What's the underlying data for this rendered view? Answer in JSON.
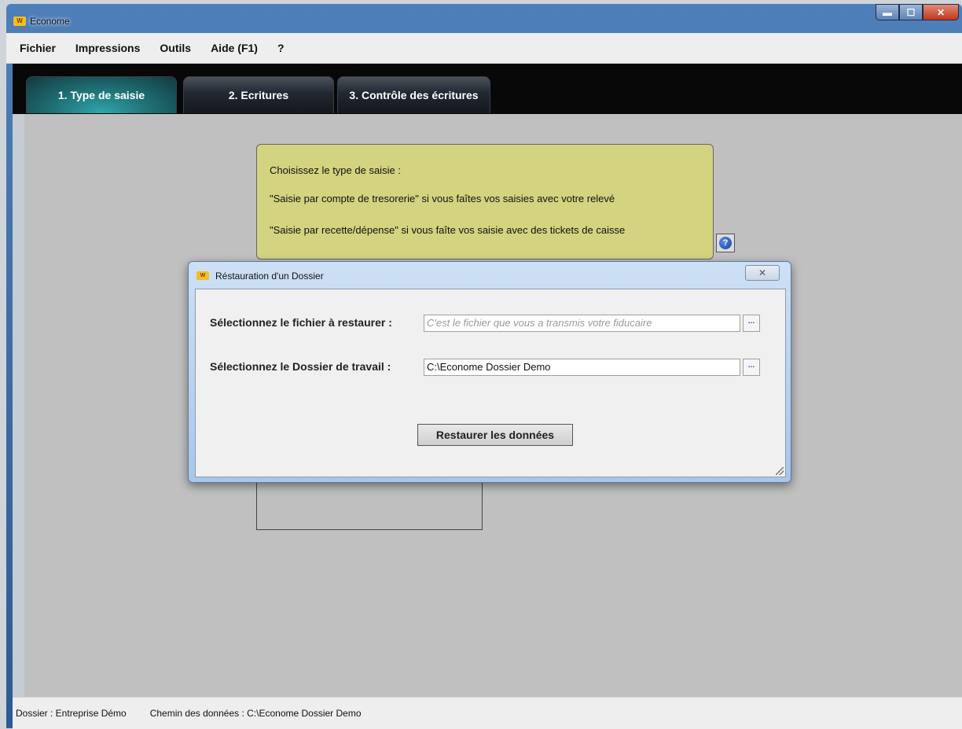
{
  "window": {
    "title": "Econome",
    "icon": "wd-app-icon",
    "controls": {
      "minimize": "▬",
      "maximize": "☐",
      "close": "✕"
    }
  },
  "menubar": {
    "items": [
      "Fichier",
      "Impressions",
      "Outils",
      "Aide (F1)",
      "?"
    ]
  },
  "tabs": [
    {
      "label": "1. Type de saisie",
      "active": true
    },
    {
      "label": "2. Ecritures",
      "active": false
    },
    {
      "label": "3. Contrôle des écritures",
      "active": false
    }
  ],
  "info_panel": {
    "line1": "Choisissez le type de saisie :",
    "line2": "\"Saisie par compte de tresorerie\" si vous faîtes vos saisies avec votre relevé",
    "line3": "\"Saisie par recette/dépense\" si vous faîte vos saisie avec des tickets de caisse"
  },
  "help_button": {
    "icon": "help-icon",
    "glyph": "?"
  },
  "dialog": {
    "title": "Réstauration d'un Dossier",
    "close_glyph": "✕",
    "file_label": "Sélectionnez le fichier à restaurer :",
    "file_placeholder": "C'est le fichier que vous a transmis votre fiducaire",
    "file_value": "",
    "folder_label": "Sélectionnez le Dossier de travail :",
    "folder_value": "C:\\Econome Dossier Demo",
    "browse_glyph": "...",
    "restore_label": "Restaurer les données"
  },
  "statusbar": {
    "dossier": "Dossier : Entreprise Démo",
    "chemin": "Chemin des données : C:\\Econome Dossier Demo"
  },
  "colors": {
    "info_panel_bg": "#d4d380",
    "active_tab": "#1f7277",
    "content_bg": "#c0c0c0"
  }
}
